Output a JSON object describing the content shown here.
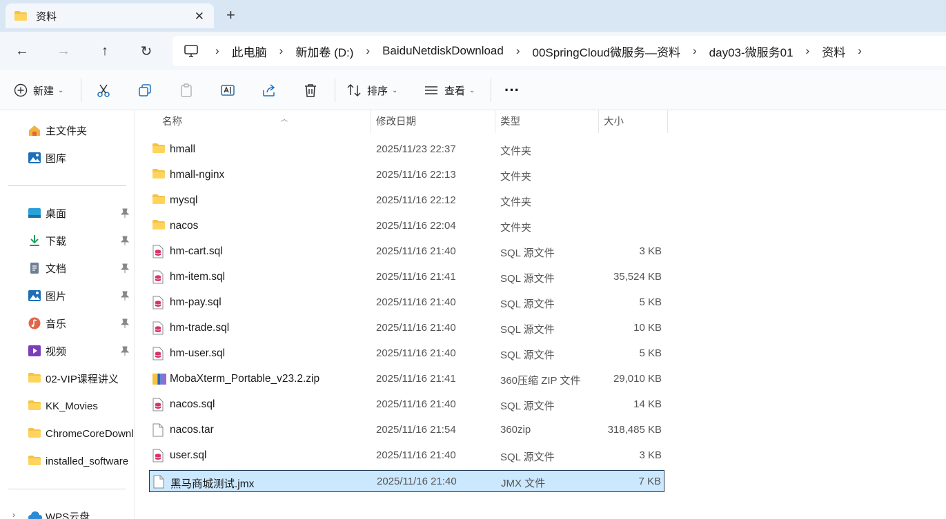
{
  "window": {
    "tab_title": "资料",
    "close_glyph": "✕",
    "newtab_glyph": "+"
  },
  "nav": {
    "back": "←",
    "forward": "→",
    "up": "↑",
    "refresh": "↻",
    "breadcrumb": [
      "此电脑",
      "新加卷 (D:)",
      "BaiduNetdiskDownload",
      "00SpringCloud微服务—资料",
      "day03-微服务01",
      "资料"
    ]
  },
  "toolbar": {
    "new_label": "新建",
    "sort_label": "排序",
    "view_label": "查看",
    "more_glyph": "···"
  },
  "sidebar": {
    "home": "主文件夹",
    "gallery": "图库",
    "pinned": [
      "桌面",
      "下载",
      "文档",
      "图片",
      "音乐",
      "视频"
    ],
    "folders": [
      "02-VIP课程讲义",
      "KK_Movies",
      "ChromeCoreDownloads",
      "installed_software"
    ],
    "wps": "WPS云盘"
  },
  "columns": {
    "name": "名称",
    "date": "修改日期",
    "type": "类型",
    "size": "大小"
  },
  "files": [
    {
      "name": "hmall",
      "date": "2025/11/23 22:37",
      "type": "文件夹",
      "size": "",
      "kind": "folder"
    },
    {
      "name": "hmall-nginx",
      "date": "2025/11/16 22:13",
      "type": "文件夹",
      "size": "",
      "kind": "folder"
    },
    {
      "name": "mysql",
      "date": "2025/11/16 22:12",
      "type": "文件夹",
      "size": "",
      "kind": "folder"
    },
    {
      "name": "nacos",
      "date": "2025/11/16 22:04",
      "type": "文件夹",
      "size": "",
      "kind": "folder"
    },
    {
      "name": "hm-cart.sql",
      "date": "2025/11/16 21:40",
      "type": "SQL 源文件",
      "size": "3 KB",
      "kind": "sql"
    },
    {
      "name": "hm-item.sql",
      "date": "2025/11/16 21:41",
      "type": "SQL 源文件",
      "size": "35,524 KB",
      "kind": "sql"
    },
    {
      "name": "hm-pay.sql",
      "date": "2025/11/16 21:40",
      "type": "SQL 源文件",
      "size": "5 KB",
      "kind": "sql"
    },
    {
      "name": "hm-trade.sql",
      "date": "2025/11/16 21:40",
      "type": "SQL 源文件",
      "size": "10 KB",
      "kind": "sql"
    },
    {
      "name": "hm-user.sql",
      "date": "2025/11/16 21:40",
      "type": "SQL 源文件",
      "size": "5 KB",
      "kind": "sql"
    },
    {
      "name": "MobaXterm_Portable_v23.2.zip",
      "date": "2025/11/16 21:41",
      "type": "360压缩 ZIP 文件",
      "size": "29,010 KB",
      "kind": "zip"
    },
    {
      "name": "nacos.sql",
      "date": "2025/11/16 21:40",
      "type": "SQL 源文件",
      "size": "14 KB",
      "kind": "sql"
    },
    {
      "name": "nacos.tar",
      "date": "2025/11/16 21:54",
      "type": "360zip",
      "size": "318,485 KB",
      "kind": "file"
    },
    {
      "name": "user.sql",
      "date": "2025/11/16 21:40",
      "type": "SQL 源文件",
      "size": "3 KB",
      "kind": "sql"
    },
    {
      "name": "黑马商城测试.jmx",
      "date": "2025/11/16 21:40",
      "type": "JMX 文件",
      "size": "7 KB",
      "kind": "file",
      "selected": true
    }
  ],
  "colors": {
    "titlebar": "#d9e6f3",
    "selection": "#cce8ff",
    "folder": "#f5c242",
    "sql": "#d6336c"
  }
}
